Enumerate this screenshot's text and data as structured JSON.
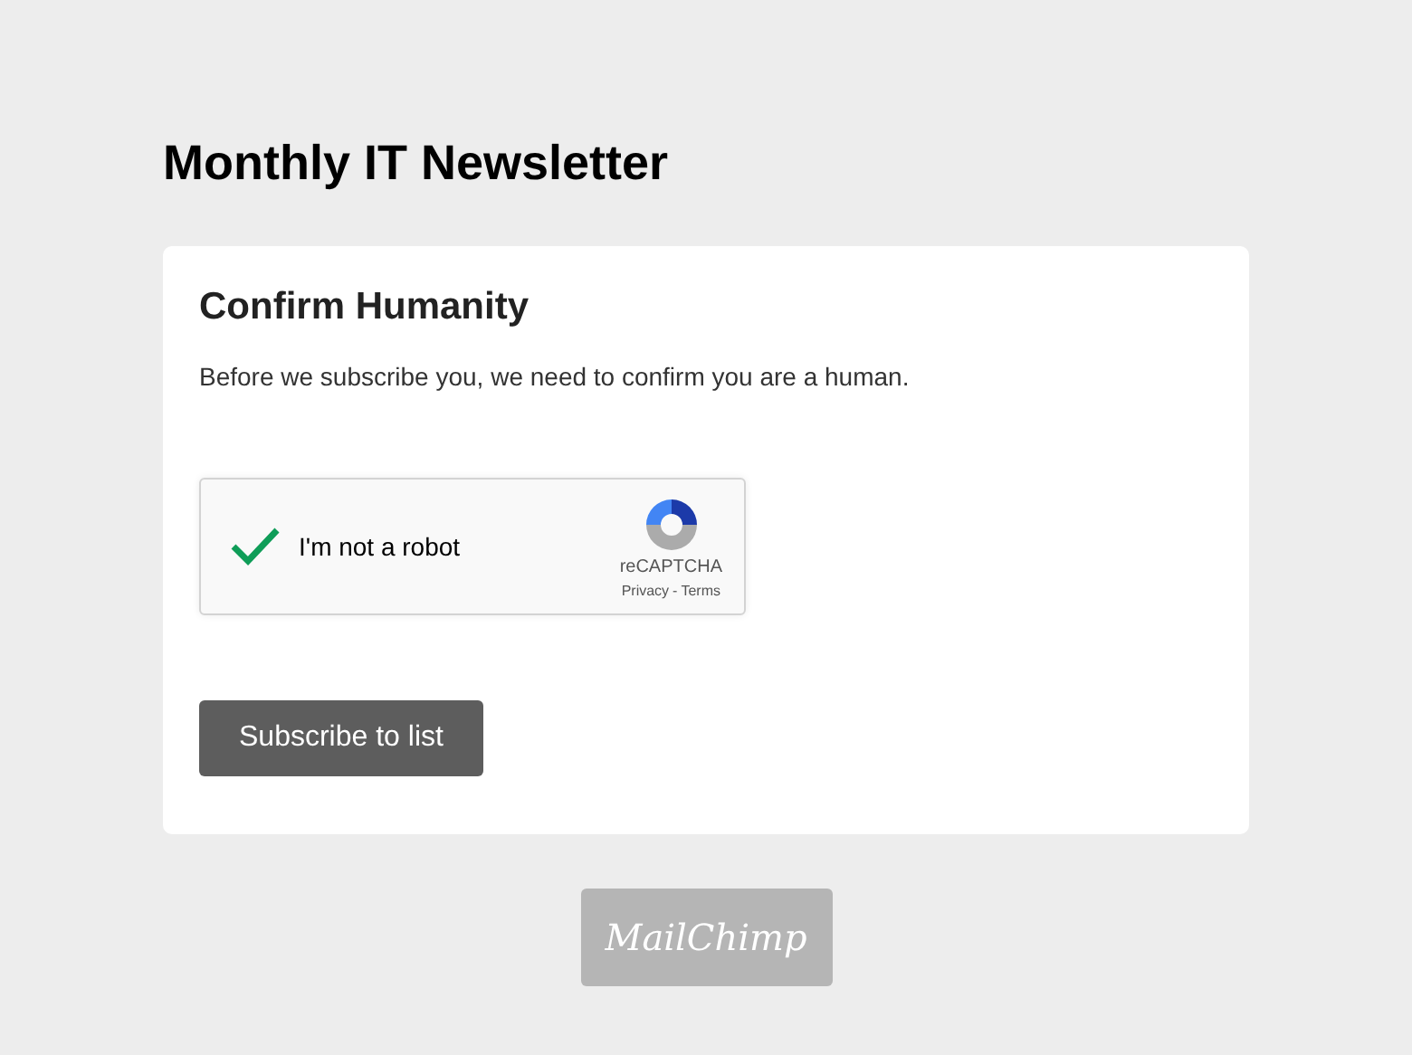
{
  "page_title": "Monthly IT Newsletter",
  "card": {
    "heading": "Confirm Humanity",
    "text": "Before we subscribe you, we need to confirm you are a human."
  },
  "captcha": {
    "label": "I'm not a robot",
    "checked": true,
    "brand": "reCAPTCHA",
    "links": [
      "Privacy",
      "Terms"
    ],
    "separator": "-"
  },
  "submit_button": "Subscribe to list",
  "footer_logo": "MailChimp"
}
